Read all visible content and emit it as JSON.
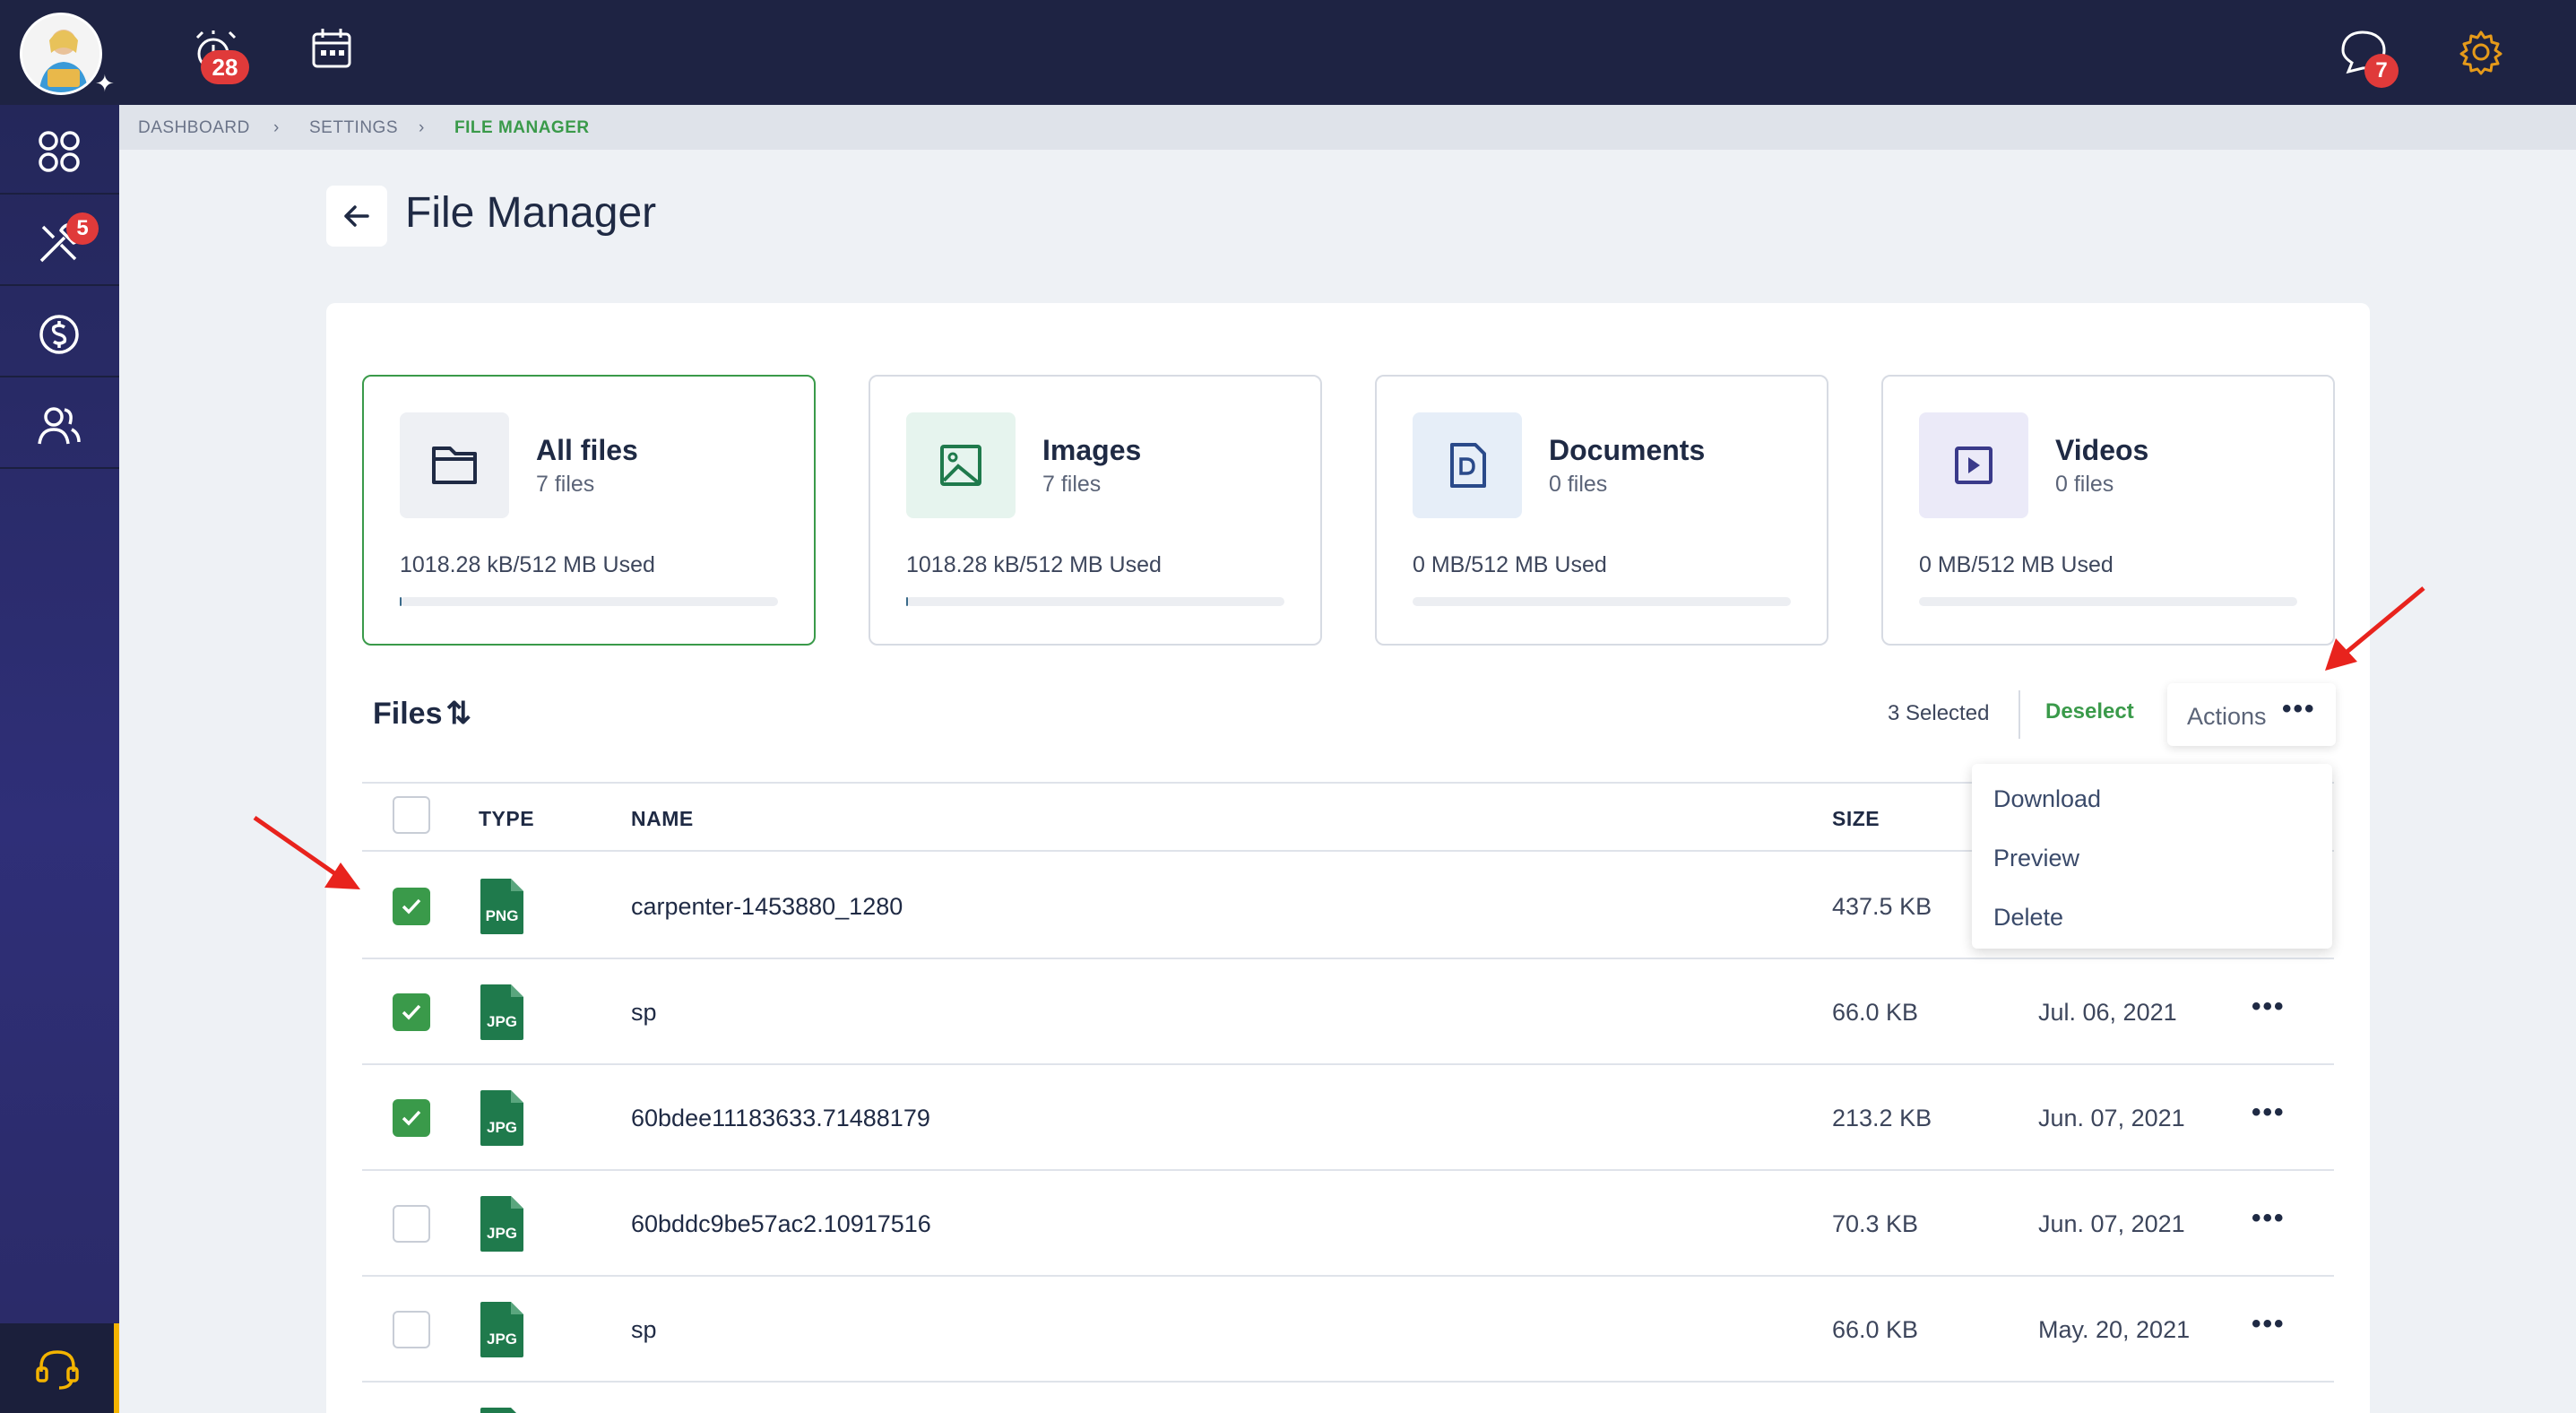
{
  "topbar": {
    "alarm_badge": "28",
    "chat_badge": "7"
  },
  "sidebar": {
    "items": [
      {
        "icon": "apps-grid-icon"
      },
      {
        "icon": "tools-icon",
        "badge": "5"
      },
      {
        "icon": "dollar-icon"
      },
      {
        "icon": "users-icon"
      }
    ],
    "bottom_icon": "headset-icon"
  },
  "breadcrumb": {
    "items": [
      "DASHBOARD",
      "SETTINGS",
      "FILE MANAGER"
    ]
  },
  "page": {
    "title": "File Manager"
  },
  "stats": [
    {
      "title": "All files",
      "count": "7 files",
      "used": "1018.28 kB/512 MB Used",
      "fill": 0.002
    },
    {
      "title": "Images",
      "count": "7 files",
      "used": "1018.28 kB/512 MB Used",
      "fill": 0.002
    },
    {
      "title": "Documents",
      "count": "0 files",
      "used": "0 MB/512 MB Used",
      "fill": 0
    },
    {
      "title": "Videos",
      "count": "0 files",
      "used": "0 MB/512 MB Used",
      "fill": 0
    }
  ],
  "files": {
    "heading": "Files",
    "selected_text": "3 Selected",
    "deselect_label": "Deselect",
    "actions_label": "Actions",
    "menu": [
      "Download",
      "Preview",
      "Delete"
    ],
    "columns": {
      "type": "TYPE",
      "name": "NAME",
      "size": "SIZE"
    },
    "rows": [
      {
        "type": "PNG",
        "name": "carpenter-1453880_1280",
        "size": "437.5 KB",
        "date": "",
        "checked": true
      },
      {
        "type": "JPG",
        "name": "sp",
        "size": "66.0 KB",
        "date": "Jul. 06, 2021",
        "checked": true
      },
      {
        "type": "JPG",
        "name": "60bdee11183633.71488179",
        "size": "213.2 KB",
        "date": "Jun. 07, 2021",
        "checked": true
      },
      {
        "type": "JPG",
        "name": "60bddc9be57ac2.10917516",
        "size": "70.3 KB",
        "date": "Jun. 07, 2021",
        "checked": false
      },
      {
        "type": "JPG",
        "name": "sp",
        "size": "66.0 KB",
        "date": "May. 20, 2021",
        "checked": false
      }
    ]
  },
  "colors": {
    "accent_green": "#3a9a4a",
    "file_icon_green": "#1f7a4c",
    "nav_bg": "#1e2343",
    "badge_red": "#e03a3a",
    "annotation_red": "#e8231d"
  }
}
